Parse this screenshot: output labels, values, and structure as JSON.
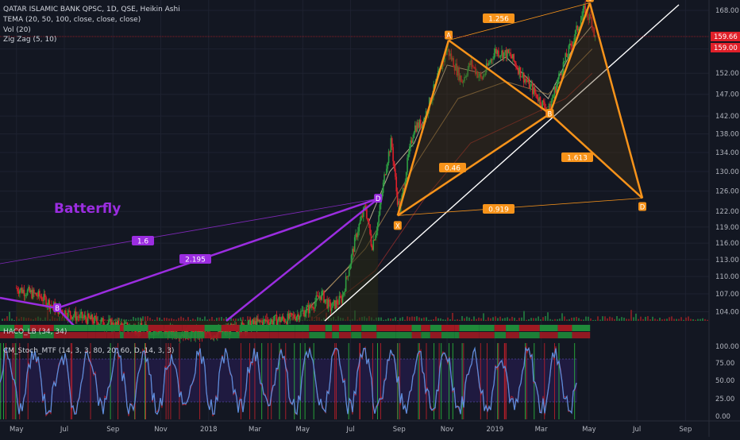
{
  "legend": {
    "symbol_line": "QATAR ISLAMIC BANK QPSC, 1D, QSE, Heikin Ashi",
    "tema_line": "TEMA (20, 50, 100, close, close, close)",
    "vol_line": "Vol (20)",
    "zigzag_line": "Zig Zag (5, 10)"
  },
  "pattern_title": "Batterfly",
  "sub_panels": {
    "haco_label": "HACO_LB (34, 34)",
    "stoch_label": "CM_Stoch_MTF (14, 3, 3, 80, 20, 60, D, 14, 3, 3)"
  },
  "colors": {
    "background": "#131722",
    "purple": "#9b2de0",
    "orange": "#f7931a",
    "up_candle": "#2ea043",
    "down_candle": "#e0202a",
    "price_label": "#e0202a",
    "stoch_line": "#5b8cdb",
    "stoch_fill": "#2a1d5a",
    "axis_text": "#b2b5be",
    "trendline": "#ffffff"
  },
  "chart_data": {
    "type": "candlestick",
    "chart_style": "Heikin Ashi",
    "timeframe": "1D",
    "x_axis": {
      "ticks": [
        "May",
        "Jul",
        "Sep",
        "Nov",
        "2018",
        "Mar",
        "May",
        "Jul",
        "Sep",
        "Nov",
        "2019",
        "Mar",
        "May",
        "Jul",
        "Sep"
      ],
      "range": [
        "2017-05",
        "2019-09"
      ]
    },
    "y_axis": {
      "scale": "log",
      "range": [
        102.5,
        169.5
      ],
      "ticks": [
        104.0,
        107.0,
        110.0,
        113.0,
        116.0,
        119.0,
        122.0,
        126.0,
        130.0,
        134.0,
        138.0,
        142.0,
        147.0,
        152.0,
        158.0,
        168.0
      ]
    },
    "price_labels": [
      {
        "value": "159.66",
        "color": "#e0202a"
      },
      {
        "value": "159.00",
        "color": "#e0202a"
      }
    ],
    "series": [
      {
        "name": "Price (Heikin Ashi close, approx.)",
        "points": [
          [
            "2017-05-01",
            108.0
          ],
          [
            "2017-06-01",
            106.5
          ],
          [
            "2017-06-20",
            104.6
          ],
          [
            "2017-07-15",
            103.3
          ],
          [
            "2017-09-01",
            101.8
          ],
          [
            "2017-11-01",
            100.8
          ],
          [
            "2018-01-01",
            100.2
          ],
          [
            "2018-02-15",
            101.6
          ],
          [
            "2018-03-15",
            102.4
          ],
          [
            "2018-04-15",
            102.9
          ],
          [
            "2018-05-10",
            104.6
          ],
          [
            "2018-05-25",
            107.0
          ],
          [
            "2018-06-05",
            104.6
          ],
          [
            "2018-06-20",
            106.2
          ],
          [
            "2018-07-01",
            112.8
          ],
          [
            "2018-07-10",
            118.5
          ],
          [
            "2018-07-20",
            123.0
          ],
          [
            "2018-07-28",
            115.4
          ],
          [
            "2018-08-05",
            120.0
          ],
          [
            "2018-08-15",
            131.0
          ],
          [
            "2018-08-22",
            136.5
          ],
          [
            "2018-08-29",
            125.0
          ],
          [
            "2018-09-02",
            122.0
          ],
          [
            "2018-09-10",
            130.5
          ],
          [
            "2018-09-20",
            139.5
          ],
          [
            "2018-10-01",
            140.5
          ],
          [
            "2018-10-15",
            148.0
          ],
          [
            "2018-11-01",
            158.0
          ],
          [
            "2018-11-20",
            150.0
          ],
          [
            "2018-12-01",
            154.5
          ],
          [
            "2018-12-15",
            150.5
          ],
          [
            "2019-01-01",
            157.5
          ],
          [
            "2019-01-20",
            156.5
          ],
          [
            "2019-02-05",
            151.5
          ],
          [
            "2019-02-20",
            147.5
          ],
          [
            "2019-03-10",
            143.0
          ],
          [
            "2019-03-25",
            152.0
          ],
          [
            "2019-04-10",
            160.0
          ],
          [
            "2019-04-25",
            168.0
          ],
          [
            "2019-05-05",
            165.0
          ],
          [
            "2019-05-10",
            159.0
          ]
        ]
      },
      {
        "name": "TEMA (20)",
        "points": [
          [
            "2018-05-01",
            103.6
          ],
          [
            "2018-07-01",
            112.0
          ],
          [
            "2018-08-20",
            130.0
          ],
          [
            "2018-09-20",
            136.0
          ],
          [
            "2018-11-01",
            154.0
          ],
          [
            "2018-12-15",
            152.0
          ],
          [
            "2019-01-15",
            156.0
          ],
          [
            "2019-03-10",
            146.0
          ],
          [
            "2019-04-10",
            158.0
          ],
          [
            "2019-05-05",
            164.0
          ]
        ]
      },
      {
        "name": "TEMA (50)",
        "points": [
          [
            "2018-05-01",
            103.3
          ],
          [
            "2018-07-20",
            115.0
          ],
          [
            "2018-09-20",
            131.0
          ],
          [
            "2018-11-15",
            146.0
          ],
          [
            "2019-01-15",
            150.0
          ],
          [
            "2019-03-10",
            147.0
          ],
          [
            "2019-05-05",
            158.0
          ]
        ]
      },
      {
        "name": "TEMA (100)",
        "points": [
          [
            "2018-05-15",
            102.9
          ],
          [
            "2018-08-01",
            111.0
          ],
          [
            "2018-10-01",
            124.0
          ],
          [
            "2018-12-01",
            136.0
          ],
          [
            "2019-02-01",
            141.0
          ],
          [
            "2019-04-01",
            146.0
          ],
          [
            "2019-05-05",
            152.0
          ]
        ]
      }
    ],
    "zigzag_patterns": [
      {
        "name": "Batterfly",
        "color": "#9b2de0",
        "points": [
          {
            "label": "B",
            "date": "2017-06-22",
            "price": 104.6
          },
          {
            "label": "D",
            "date": "2018-08-05",
            "price": 124.5
          }
        ],
        "legs": [
          {
            "from": "2017-05-01",
            "to": "B"
          },
          {
            "from": "B",
            "to": "2017-08-05"
          },
          {
            "from": "B",
            "to": "D"
          },
          {
            "from": "2018-01-20",
            "to": "D"
          }
        ],
        "ratio_lines": [
          {
            "label": "1.6",
            "from": "2017-05-01",
            "to": "D"
          },
          {
            "label": "2.195",
            "from": "B",
            "to": "D"
          }
        ]
      },
      {
        "name": "Butterfly",
        "color": "#f7931a",
        "points": [
          {
            "label": "X",
            "date": "2018-08-30",
            "price": 121.2
          },
          {
            "label": "A",
            "date": "2018-11-03",
            "price": 160.2
          },
          {
            "label": "B",
            "date": "2019-03-12",
            "price": 142.5
          },
          {
            "label": "C",
            "date": "2019-05-02",
            "price": 170.0
          },
          {
            "label": "D",
            "date": "2019-07-08",
            "price": 124.6
          }
        ],
        "ratio_lines": [
          {
            "label": "1.256",
            "from": "A",
            "to": "C"
          },
          {
            "label": "0.46",
            "from": "X",
            "to": "B"
          },
          {
            "label": "0.919",
            "from": "X",
            "to": "D"
          },
          {
            "label": "1.613",
            "from": "B",
            "to": "D"
          }
        ]
      }
    ],
    "trendline": {
      "from": [
        "2018-07-20",
        102.5
      ],
      "to": [
        "2019-09-15",
        169.0
      ]
    }
  }
}
